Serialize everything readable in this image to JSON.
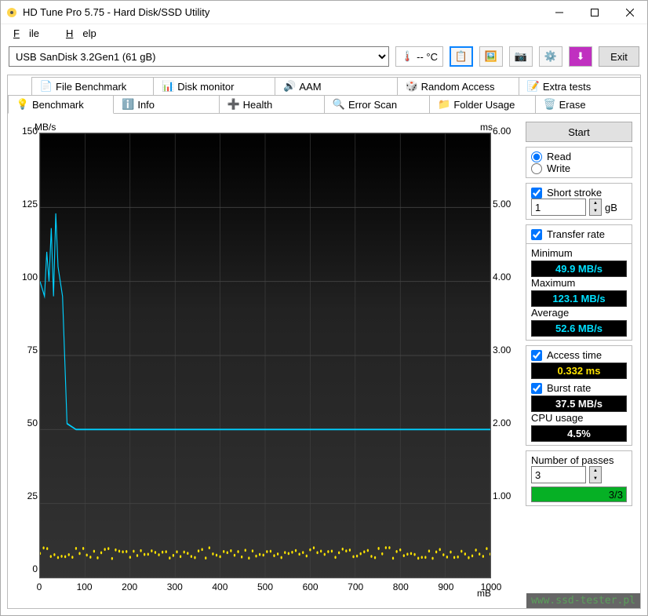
{
  "title": "HD Tune Pro 5.75 - Hard Disk/SSD Utility",
  "menu": {
    "file": "File",
    "help": "Help"
  },
  "device": "USB SanDisk 3.2Gen1 (61 gB)",
  "temp": "-- °C",
  "exit": "Exit",
  "tabs_top": [
    {
      "label": "File Benchmark"
    },
    {
      "label": "Disk monitor"
    },
    {
      "label": "AAM"
    },
    {
      "label": "Random Access"
    },
    {
      "label": "Extra tests"
    }
  ],
  "tabs_bottom": [
    {
      "label": "Benchmark"
    },
    {
      "label": "Info"
    },
    {
      "label": "Health"
    },
    {
      "label": "Error Scan"
    },
    {
      "label": "Folder Usage"
    },
    {
      "label": "Erase"
    }
  ],
  "axis": {
    "ylabel": "MB/s",
    "y2label": "ms",
    "xunit": "mB"
  },
  "yticks": [
    "150",
    "125",
    "100",
    "75",
    "50",
    "25",
    "0"
  ],
  "y2ticks": [
    "6.00",
    "5.00",
    "4.00",
    "3.00",
    "2.00",
    "1.00"
  ],
  "xticks": [
    "0",
    "100",
    "200",
    "300",
    "400",
    "500",
    "600",
    "700",
    "800",
    "900",
    "1000"
  ],
  "sidebar": {
    "start": "Start",
    "read": "Read",
    "write": "Write",
    "short_stroke": "Short stroke",
    "short_stroke_val": "1",
    "short_stroke_unit": "gB",
    "transfer_rate": "Transfer rate",
    "minimum": "Minimum",
    "minimum_val": "49.9 MB/s",
    "maximum": "Maximum",
    "maximum_val": "123.1 MB/s",
    "average": "Average",
    "average_val": "52.6 MB/s",
    "access_time": "Access time",
    "access_time_val": "0.332 ms",
    "burst_rate": "Burst rate",
    "burst_rate_val": "37.5 MB/s",
    "cpu_usage": "CPU usage",
    "cpu_usage_val": "4.5%",
    "passes": "Number of passes",
    "passes_val": "3",
    "progress": "3/3"
  },
  "watermark": "www.ssd-tester.pl",
  "chart_data": {
    "type": "line",
    "title": "Benchmark",
    "xlabel": "mB",
    "ylabel_left": "MB/s",
    "ylabel_right": "ms",
    "xlim": [
      0,
      1000
    ],
    "ylim_left": [
      0,
      150
    ],
    "ylim_right": [
      0,
      6
    ],
    "series": [
      {
        "name": "Transfer rate (MB/s)",
        "axis": "left",
        "color": "#00d0ff",
        "x": [
          0,
          10,
          15,
          20,
          25,
          30,
          35,
          40,
          50,
          60,
          80,
          100,
          200,
          300,
          400,
          500,
          600,
          700,
          800,
          900,
          1000
        ],
        "values": [
          100,
          95,
          110,
          100,
          118,
          95,
          123,
          105,
          95,
          52,
          50,
          50,
          50,
          50,
          50,
          50,
          50,
          50,
          50,
          50,
          50
        ]
      },
      {
        "name": "Access time (ms)",
        "axis": "right",
        "color": "#ffe400",
        "x": [
          0,
          100,
          200,
          300,
          400,
          500,
          600,
          700,
          800,
          900,
          1000
        ],
        "values": [
          0.33,
          0.33,
          0.33,
          0.33,
          0.33,
          0.33,
          0.33,
          0.33,
          0.33,
          0.33,
          0.33
        ]
      }
    ]
  }
}
